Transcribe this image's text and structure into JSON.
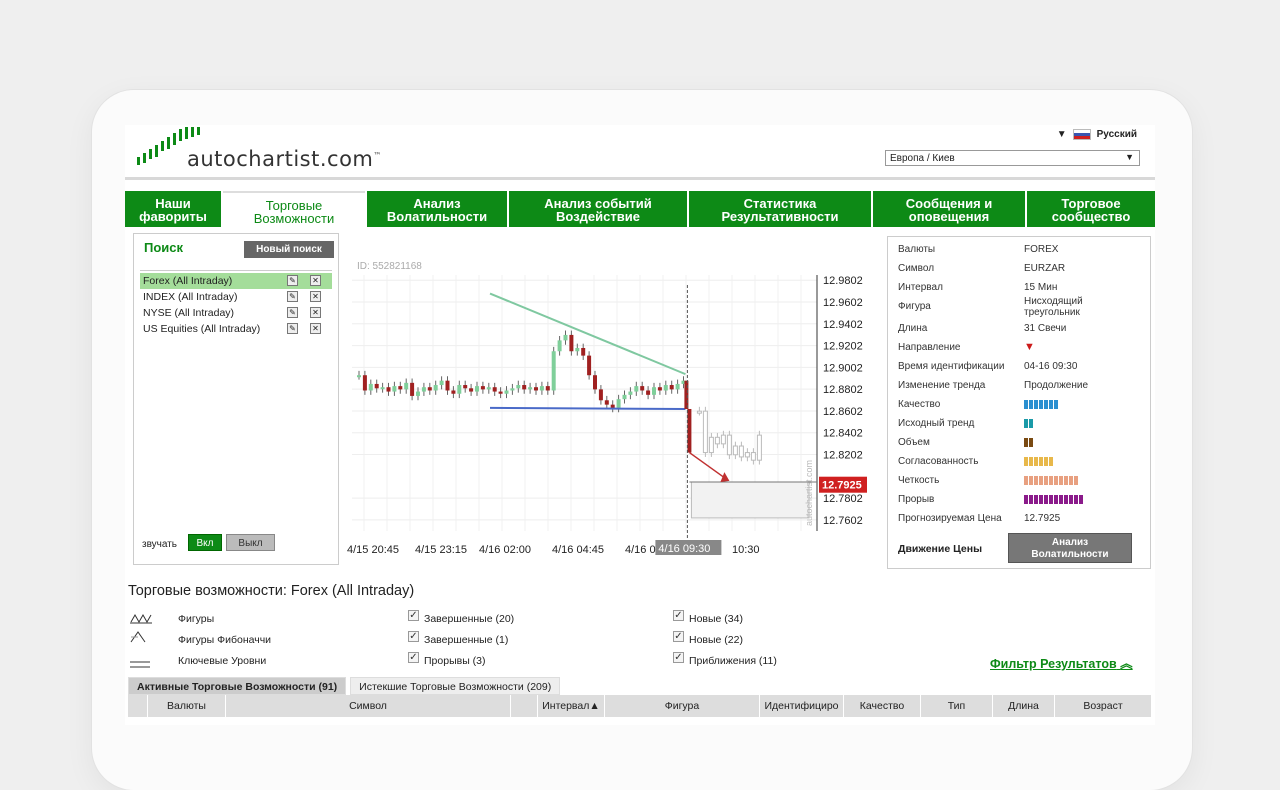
{
  "header": {
    "logo_text": "autochartist.com",
    "logo_tm": "™",
    "language": "Русский",
    "timezone": "Европа / Киев"
  },
  "nav": [
    {
      "label": "Наши\nфавориты",
      "active": false
    },
    {
      "label": "Торговые\nВозможности",
      "active": true
    },
    {
      "label": "Анализ\nВолатильности",
      "active": false
    },
    {
      "label": "Анализ событий\nВоздействие",
      "active": false
    },
    {
      "label": "Статистика\nРезультативности",
      "active": false
    },
    {
      "label": "Сообщения и\nоповещения",
      "active": false
    },
    {
      "label": "Торговое\nсообщество",
      "active": false
    }
  ],
  "search": {
    "title": "Поиск",
    "new_search": "Новый поиск",
    "items": [
      {
        "label": "Forex (All Intraday)",
        "selected": true
      },
      {
        "label": "INDEX (All Intraday)",
        "selected": false
      },
      {
        "label": "NYSE (All Intraday)",
        "selected": false
      },
      {
        "label": "US Equities (All Intraday)",
        "selected": false
      }
    ],
    "sound_label": "звучать",
    "on_label": "Вкл",
    "off_label": "Выкл"
  },
  "chart_data": {
    "type": "candlestick",
    "id_label": "ID: 552821168",
    "watermark": "autochartist.com",
    "y_ticks": [
      "12.9802",
      "12.9602",
      "12.9402",
      "12.9202",
      "12.9002",
      "12.8802",
      "12.8602",
      "12.8402",
      "12.8202",
      "12.7802",
      "12.7602"
    ],
    "x_ticks": [
      "4/15 20:45",
      "4/15 23:15",
      "4/16 02:00",
      "4/16 04:45",
      "4/16 07:",
      "10:30"
    ],
    "ylim": [
      12.75,
      12.985
    ],
    "price_label": "12.7925",
    "time_label": "4/16 09:30",
    "series_pre": [
      12.893,
      12.879,
      12.885,
      12.881,
      12.882,
      12.878,
      12.883,
      12.88,
      12.886,
      12.874,
      12.878,
      12.882,
      12.879,
      12.884,
      12.888,
      12.879,
      12.876,
      12.884,
      12.881,
      12.878,
      12.883,
      12.88,
      12.882,
      12.878,
      12.876,
      12.879,
      12.881,
      12.884,
      12.88,
      12.882,
      12.879,
      12.883,
      12.879,
      12.915,
      12.925,
      12.93,
      12.915,
      12.918,
      12.911,
      12.893,
      12.88,
      12.87,
      12.866,
      12.863,
      12.871,
      12.875,
      12.878,
      12.883,
      12.879,
      12.875,
      12.882,
      12.879,
      12.884,
      12.88,
      12.885,
      12.888
    ],
    "series_post": [
      12.86,
      12.822,
      12.836,
      12.83,
      12.838,
      12.82,
      12.828,
      12.818,
      12.822,
      12.815,
      12.838
    ]
  },
  "info": {
    "rows": [
      {
        "label": "Валюты",
        "value": "FOREX"
      },
      {
        "label": "Символ",
        "value": "EURZAR"
      },
      {
        "label": "Интервал",
        "value": "15 Мин"
      },
      {
        "label": "Фигура",
        "value": "Нисходящий\nтреугольник"
      },
      {
        "label": "Длина",
        "value": "31 Свечи"
      },
      {
        "label": "Направление",
        "value": ""
      },
      {
        "label": "Время идентификации",
        "value": "04-16 09:30"
      },
      {
        "label": "Изменение тренда",
        "value": "Продолжение"
      },
      {
        "label": "Качество",
        "value": ""
      },
      {
        "label": "Исходный тренд",
        "value": ""
      },
      {
        "label": "Объем",
        "value": ""
      },
      {
        "label": "Согласованность",
        "value": ""
      },
      {
        "label": "Четкость",
        "value": ""
      },
      {
        "label": "Прорыв",
        "value": ""
      },
      {
        "label": "Прогнозируемая Цена",
        "value": "12.7925"
      }
    ],
    "bars": [
      {
        "row": "Качество",
        "count": 7,
        "color": "#2a8fd0"
      },
      {
        "row": "Исходный тренд",
        "count": 2,
        "color": "#1a9aa8"
      },
      {
        "row": "Объем",
        "count": 2,
        "color": "#7a4a12"
      },
      {
        "row": "Согласованность",
        "count": 6,
        "color": "#e8b84a"
      },
      {
        "row": "Четкость",
        "count": 11,
        "color": "#e8a080"
      },
      {
        "row": "Прорыв",
        "count": 12,
        "color": "#8a1a8a"
      }
    ],
    "direction_color": "#cc1a1a",
    "move_label": "Движение Цены",
    "analysis_btn": "Анализ\nВолатильности"
  },
  "results": {
    "title": "Торговые возможности: Forex (All Intraday)",
    "legend": [
      "Фигуры",
      "Фигуры Фибоначчи",
      "Ключевые Уровни"
    ],
    "checks_col1": [
      "Завершенные (20)",
      "Завершенные (1)",
      "Прорывы (3)"
    ],
    "checks_col2": [
      "Новые (34)",
      "Новые (22)",
      "Приближения (11)"
    ],
    "filter": "Фильтр Результатов",
    "tabs": [
      "Активные Торговые Возможности (91)",
      "Истекшие Торговые Возможности (209)"
    ],
    "columns": [
      "",
      "Валюты",
      "Символ",
      "",
      "Интервал▲",
      "Фигура",
      "Идентифициро",
      "Качество",
      "Тип",
      "Длина",
      "Возраст"
    ]
  }
}
